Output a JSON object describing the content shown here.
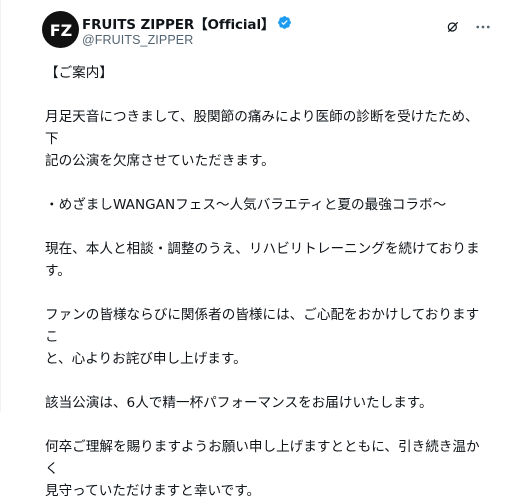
{
  "account": {
    "display_name": "FRUITS ZIPPER【Official】",
    "handle": "@FRUITS_ZIPPER",
    "avatar_monogram": "FZ",
    "verified_icon": "verified-badge-icon",
    "verified_color": "#1d9bf0"
  },
  "actions": {
    "grok_icon": "grok-icon",
    "more_icon": "more-options-icon"
  },
  "tweet": {
    "lines": [
      "【ご案内】",
      "",
      "月足天音につきまして、股関節の痛みにより医師の診断を受けたため、下",
      "記の公演を欠席させていただきます。",
      "",
      "・めざましWANGANフェス〜人気バラエティと夏の最強コラボ〜",
      "",
      "現在、本人と相談・調整のうえ、リハビリトレーニングを続けておりま",
      "す。",
      "",
      "ファンの皆様ならびに関係者の皆様には、ご心配をおかけしておりますこ",
      "と、心よりお詫び申し上げます。",
      "",
      "該当公演は、6人で精一杯パフォーマンスをお届けいたします。",
      "",
      "何卒ご理解を賜りますようお願い申し上げますとともに、引き続き温かく",
      "見守っていただけますと幸いです。"
    ]
  }
}
